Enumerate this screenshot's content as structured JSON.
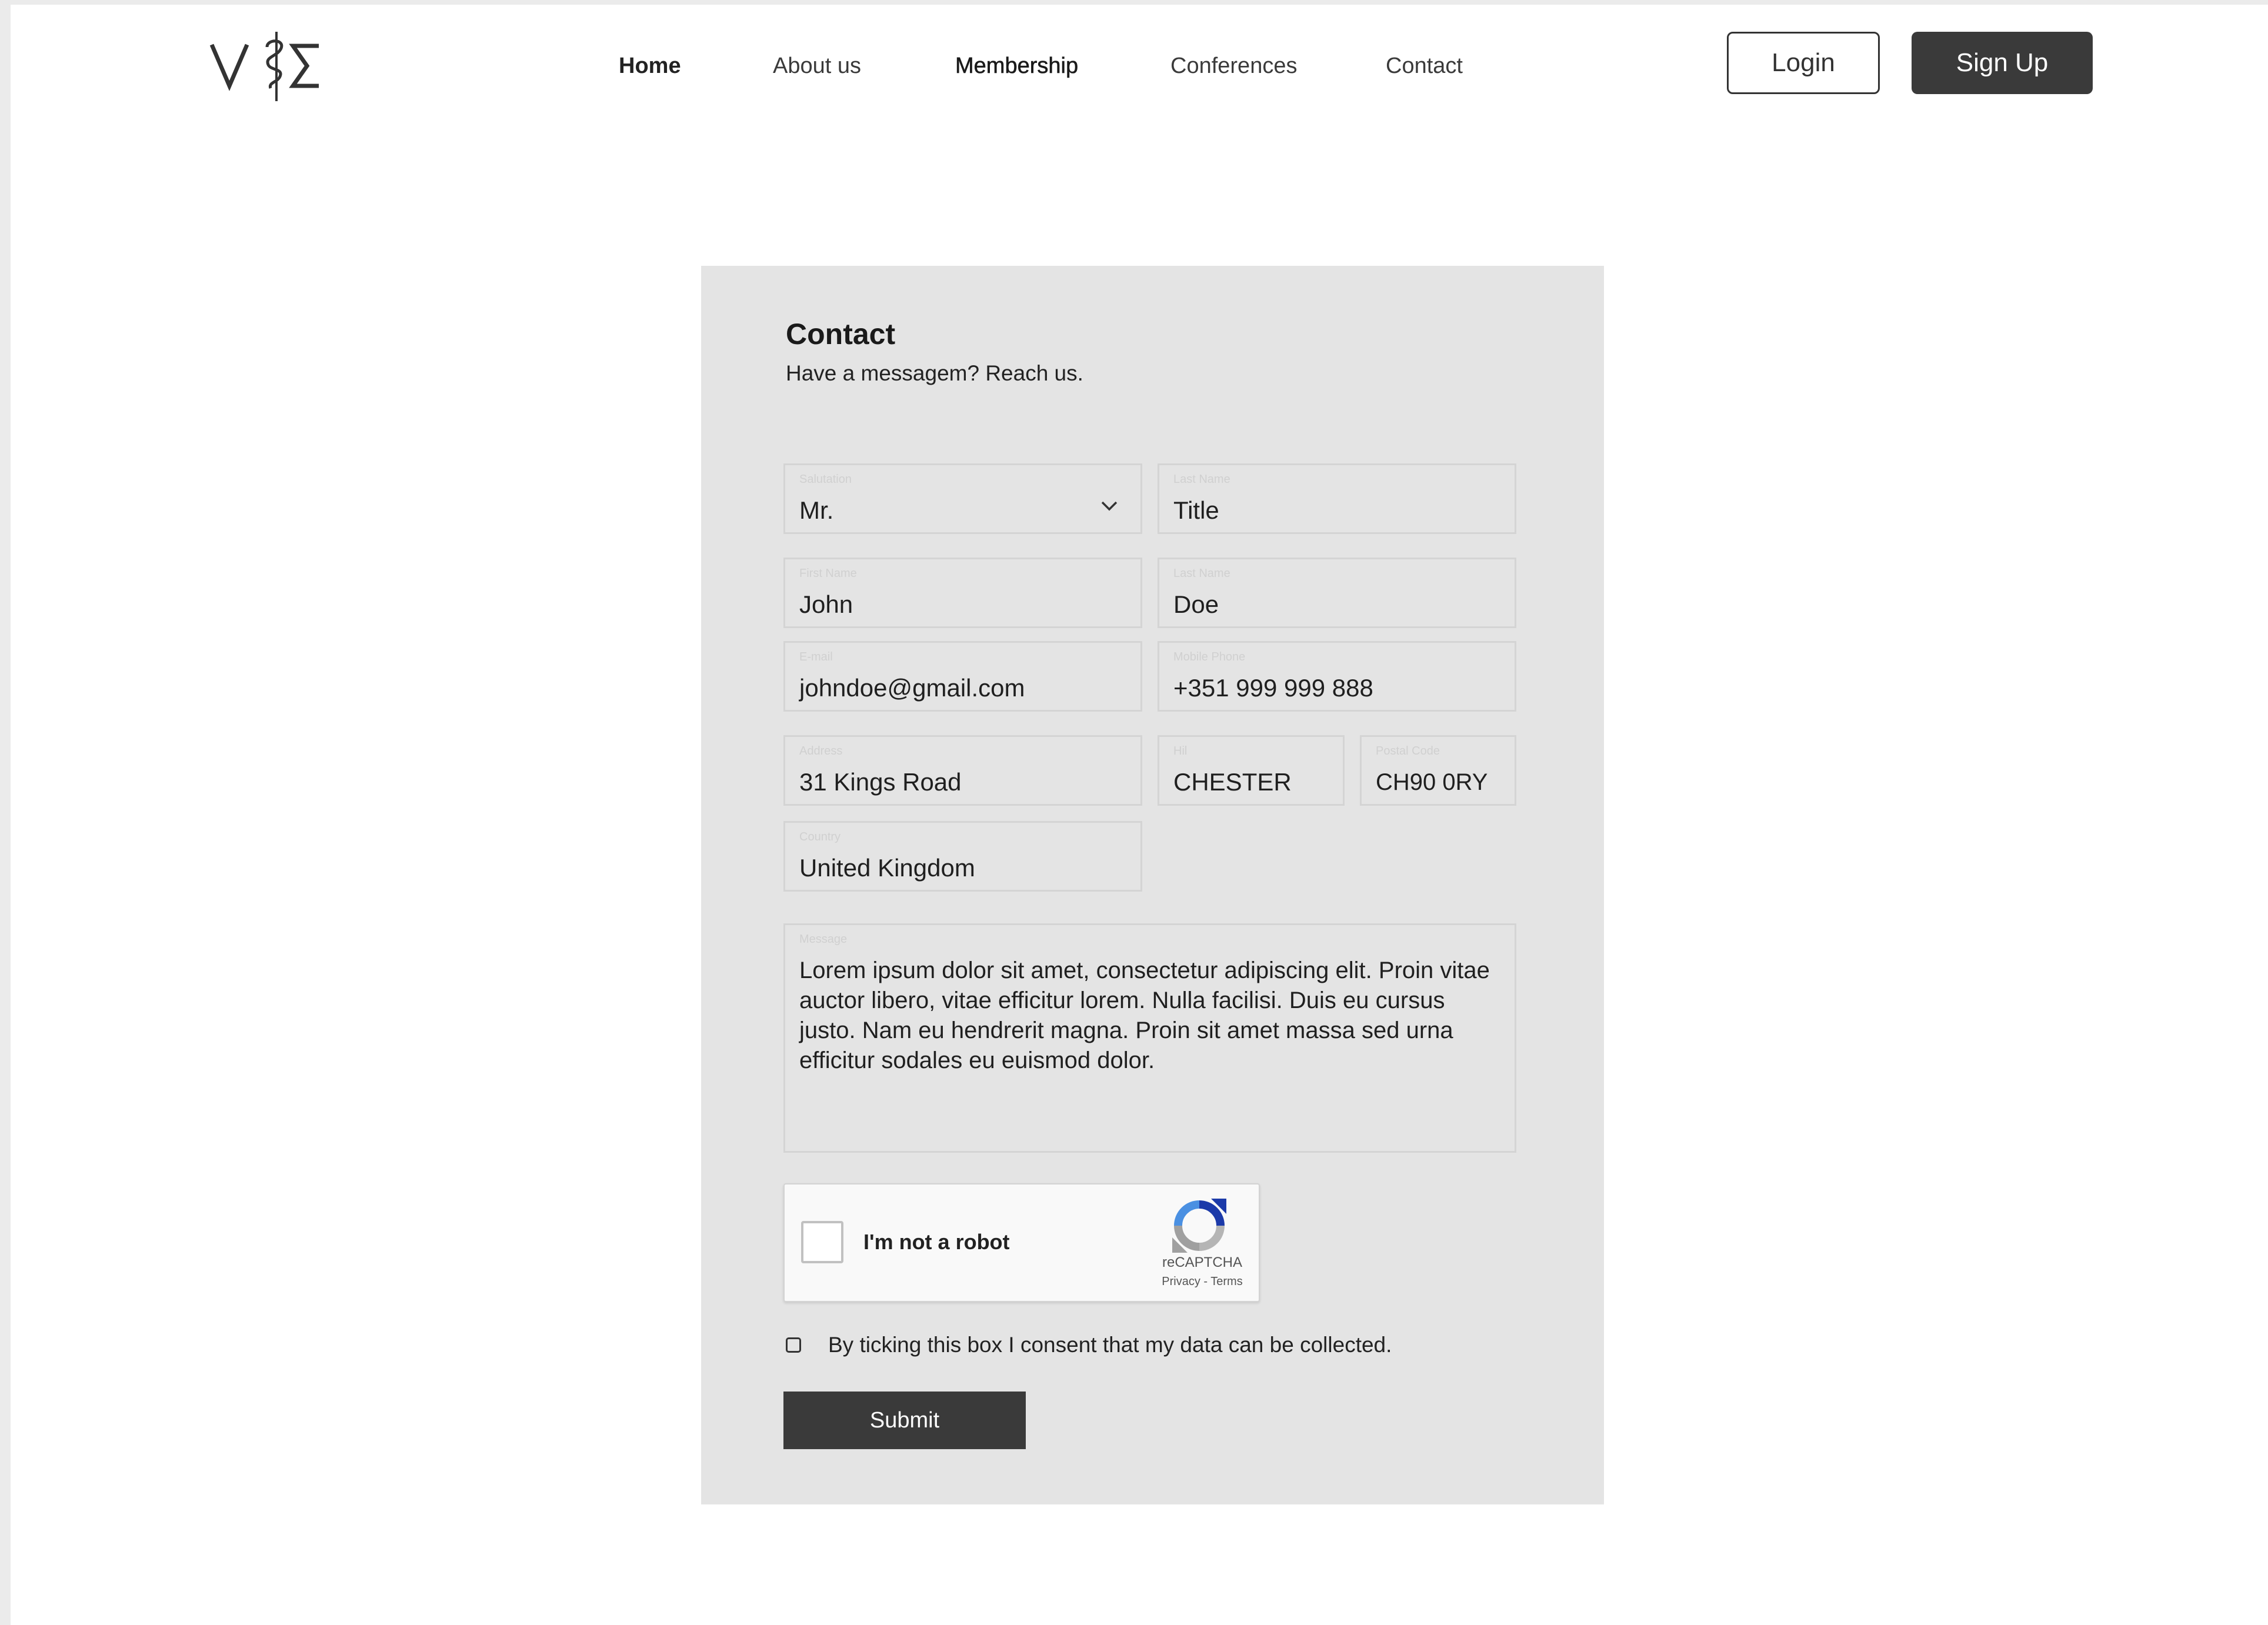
{
  "header": {
    "logo_text": "V⚕Σ",
    "nav": [
      {
        "label": "Home"
      },
      {
        "label": "About us"
      },
      {
        "label": "Membership"
      },
      {
        "label": "Conferences"
      },
      {
        "label": "Contact"
      }
    ],
    "login_label": "Login",
    "signup_label": "Sign Up"
  },
  "contact": {
    "title": "Contact",
    "subtitle": "Have a messagem? Reach us.",
    "fields": {
      "salutation": {
        "label": "Salutation",
        "value": "Mr."
      },
      "title": {
        "label": "Last Name",
        "value": "Title"
      },
      "first_name": {
        "label": "First Name",
        "value": "John"
      },
      "last_name": {
        "label": "Last Name",
        "value": "Doe"
      },
      "email": {
        "label": "E-mail",
        "value": "johndoe@gmail.com"
      },
      "mobile": {
        "label": "Mobile Phone",
        "value": "+351 999 999 888"
      },
      "address": {
        "label": "Address",
        "value": "31 Kings Road"
      },
      "city": {
        "label": "Hil",
        "value": "CHESTER"
      },
      "postal_code": {
        "label": "Postal Code",
        "value": "CH90 0RY"
      },
      "country": {
        "label": "Country",
        "value": "United Kingdom"
      },
      "message": {
        "label": "Message",
        "value": "Lorem ipsum dolor sit amet, consectetur adipiscing elit. Proin vitae auctor libero, vitae efficitur lorem. Nulla facilisi. Duis eu cursus justo. Nam eu hendrerit magna. Proin sit amet massa sed urna efficitur sodales eu euismod dolor."
      }
    },
    "recaptcha": {
      "label": "I'm not a robot",
      "brand": "reCAPTCHA",
      "privacy": "Privacy",
      "separator": " - ",
      "terms": "Terms"
    },
    "consent_text": "By ticking this box I consent that my data can be collected.",
    "submit_label": "Submit"
  },
  "colors": {
    "card_background": "#e4e4e4",
    "dark_button": "#3a3a3a",
    "field_border": "#d4d4d4"
  }
}
